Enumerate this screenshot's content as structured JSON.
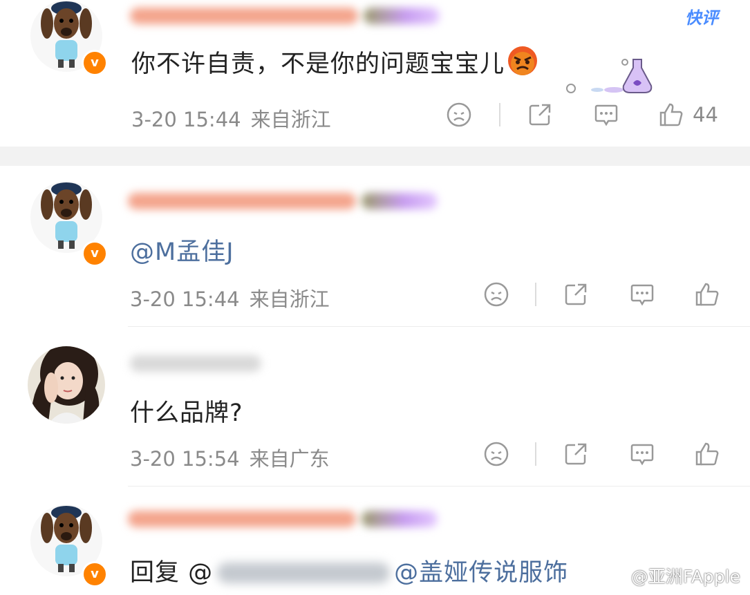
{
  "quick_comment_label": "快评",
  "comments": [
    {
      "text": "你不许自责，不是你的问题宝宝儿",
      "emoji": "angry-face",
      "time": "3-20 15:44",
      "location": "来自浙江",
      "likes": "44"
    },
    {
      "text": "@M孟佳J",
      "time": "3-20 15:44",
      "location": "来自浙江",
      "likes": ""
    },
    {
      "text": "什么品牌?",
      "time": "3-20 15:54",
      "location": "来自广东",
      "likes": ""
    },
    {
      "reply_prefix": "回复 @",
      "reply_suffix": "@盖娅传说服饰",
      "time": "",
      "location": ""
    }
  ],
  "watermark": "@亚洲FApple",
  "colors": {
    "badge": "#ff8200",
    "mention": "#4d6f9e",
    "quick": "#4a8cff",
    "meta": "#8a8a8a"
  },
  "icons": [
    "dislike-icon",
    "share-icon",
    "comment-icon",
    "like-icon",
    "verified-badge-icon",
    "weibo-icon"
  ]
}
